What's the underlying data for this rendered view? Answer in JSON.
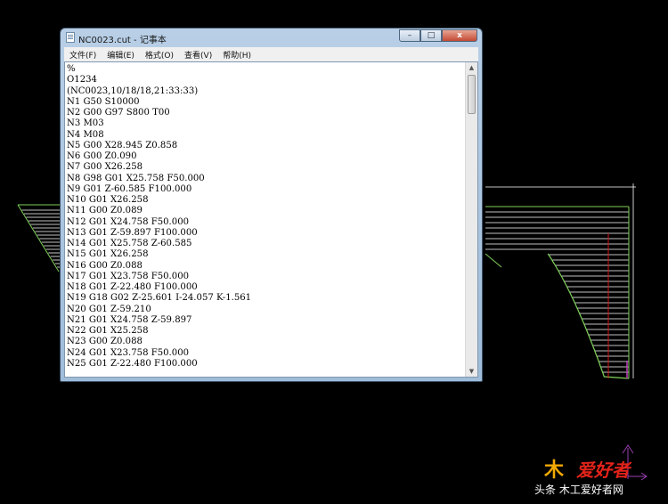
{
  "window": {
    "title": "NC0023.cut - 记事本",
    "controls": {
      "minimize": "–",
      "maximize": "□",
      "close": "x"
    }
  },
  "menu": [
    "文件(F)",
    "编辑(E)",
    "格式(O)",
    "查看(V)",
    "帮助(H)"
  ],
  "editor": {
    "lines": [
      "%",
      "O1234",
      "(NC0023,10/18/18,21:33:33)",
      "N1 G50 S10000",
      "N2 G00 G97 S800 T00",
      "N3 M03",
      "N4 M08",
      "N5 G00 X28.945 Z0.858",
      "N6 G00 Z0.090",
      "N7 G00 X26.258",
      "N8 G98 G01 X25.758 F50.000",
      "N9 G01 Z-60.585 F100.000",
      "N10 G01 X26.258",
      "N11 G00 Z0.089",
      "N12 G01 X24.758 F50.000",
      "N13 G01 Z-59.897 F100.000",
      "N14 G01 X25.758 Z-60.585",
      "N15 G01 X26.258",
      "N16 G00 Z0.088",
      "N17 G01 X23.758 F50.000",
      "N18 G01 Z-22.480 F100.000",
      "N19 G18 G02 Z-25.601 I-24.057 K-1.561",
      "N20 G01 Z-59.210",
      "N21 G01 X24.758 Z-59.897",
      "N22 G01 X25.258",
      "N23 G00 Z0.088",
      "N24 G01 X23.758 F50.000",
      "N25 G01 Z-22.480 F100.000"
    ]
  },
  "watermark": {
    "logo": "爱好者",
    "logo_glyph": "木",
    "text": "头条 木工爱好者网"
  },
  "colors": {
    "profile": "#7fd05a",
    "passes": "#ffffff",
    "accent": "#d01818",
    "axis": "#9a3fb0",
    "background": "#000000"
  }
}
